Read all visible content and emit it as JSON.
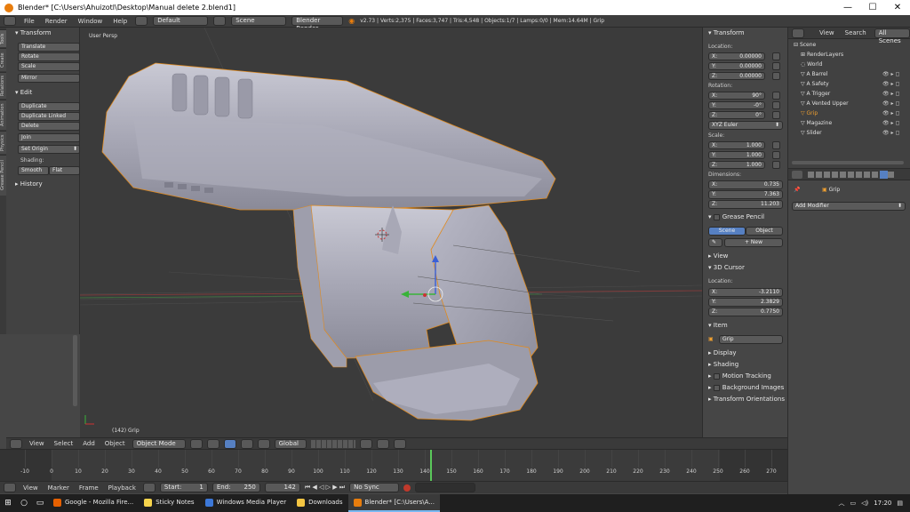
{
  "window": {
    "title": "Blender* [C:\\Users\\Ahuizotl\\Desktop\\Manual delete 2.blend1]",
    "min": "—",
    "max": "☐",
    "close": "✕"
  },
  "info_header": {
    "menus": [
      "File",
      "Render",
      "Window",
      "Help"
    ],
    "layout": "Default",
    "scene": "Scene",
    "engine": "Blender Render",
    "stats": "v2.73 | Verts:2,375 | Faces:3,747 | Tris:4,548 | Objects:1/7 | Lamps:0/0 | Mem:14.64M | Grip"
  },
  "tool_tabs": [
    "Tools",
    "Create",
    "Relations",
    "Animation",
    "Physics",
    "Grease Pencil"
  ],
  "tool_shelf": {
    "transform_head": "Transform",
    "translate": "Translate",
    "rotate": "Rotate",
    "scale": "Scale",
    "mirror": "Mirror",
    "edit_head": "Edit",
    "duplicate": "Duplicate",
    "duplicate_linked": "Duplicate Linked",
    "delete": "Delete",
    "join": "Join",
    "set_origin": "Set Origin",
    "shading_label": "Shading:",
    "smooth": "Smooth",
    "flat": "Flat",
    "history_head": "History"
  },
  "viewport": {
    "view_label": "User Persp",
    "object_label": "(142) Grip"
  },
  "npanel": {
    "transform_head": "Transform",
    "location_label": "Location:",
    "loc_x_label": "X:",
    "loc_x": "0.00000",
    "loc_y_label": "Y:",
    "loc_y": "0.00000",
    "loc_z_label": "Z:",
    "loc_z": "0.00000",
    "rotation_label": "Rotation:",
    "rot_x_label": "X:",
    "rot_x": "90°",
    "rot_y_label": "Y:",
    "rot_y": "-0°",
    "rot_z_label": "Z:",
    "rot_z": "0°",
    "rot_mode": "XYZ Euler",
    "scale_label": "Scale:",
    "scl_x_label": "X:",
    "scl_x": "1.000",
    "scl_y_label": "Y:",
    "scl_y": "1.000",
    "scl_z_label": "Z:",
    "scl_z": "1.000",
    "dim_label": "Dimensions:",
    "dim_x_label": "X:",
    "dim_x": "0.735",
    "dim_y_label": "Y:",
    "dim_y": "7.363",
    "dim_z_label": "Z:",
    "dim_z": "11.203",
    "gp_head": "Grease Pencil",
    "gp_scene": "Scene",
    "gp_object": "Object",
    "gp_new": "New",
    "view_head": "View",
    "cursor_head": "3D Cursor",
    "cursor_loc_label": "Location:",
    "cur_x_label": "X:",
    "cur_x": "-3.2110",
    "cur_y_label": "Y:",
    "cur_y": "2.3829",
    "cur_z_label": "Z:",
    "cur_z": "0.7750",
    "item_head": "Item",
    "item_name": "Grip",
    "display_head": "Display",
    "shading_head": "Shading",
    "motion_head": "Motion Tracking",
    "bg_head": "Background Images",
    "orient_head": "Transform Orientations"
  },
  "outliner": {
    "menus": [
      "View",
      "Search"
    ],
    "filter": "All Scenes",
    "rows": [
      "Scene",
      "RenderLayers",
      "World",
      "A Barrel",
      "A Safety",
      "A Trigger",
      "A Vented Upper",
      "Grip",
      "Magazine",
      "Slider"
    ]
  },
  "properties": {
    "object_name": "Grip",
    "add_modifier": "Add Modifier"
  },
  "viewport_header": {
    "menus": [
      "View",
      "Select",
      "Add",
      "Object"
    ],
    "mode": "Object Mode",
    "orientation": "Global"
  },
  "timeline": {
    "ticks": [
      "-10",
      "0",
      "10",
      "20",
      "30",
      "40",
      "50",
      "60",
      "70",
      "80",
      "90",
      "100",
      "110",
      "120",
      "130",
      "140",
      "150",
      "160",
      "170",
      "180",
      "190",
      "200",
      "210",
      "220",
      "230",
      "240",
      "250",
      "260",
      "270"
    ],
    "current_frame": 142
  },
  "timeline_header": {
    "menus": [
      "View",
      "Marker",
      "Frame",
      "Playback"
    ],
    "start": "Start:",
    "start_val": "1",
    "end": "End:",
    "end_val": "250",
    "frame": "142",
    "sync": "No Sync"
  },
  "taskbar": {
    "apps": [
      "Google - Mozilla Fire...",
      "Sticky Notes",
      "Windows Media Player",
      "Downloads",
      "Blender* [C:\\Users\\A..."
    ],
    "clock": "17:20"
  },
  "colors": {
    "accent": "#5680c2",
    "selected": "#f0a030",
    "bg": "#3b3b3b"
  }
}
